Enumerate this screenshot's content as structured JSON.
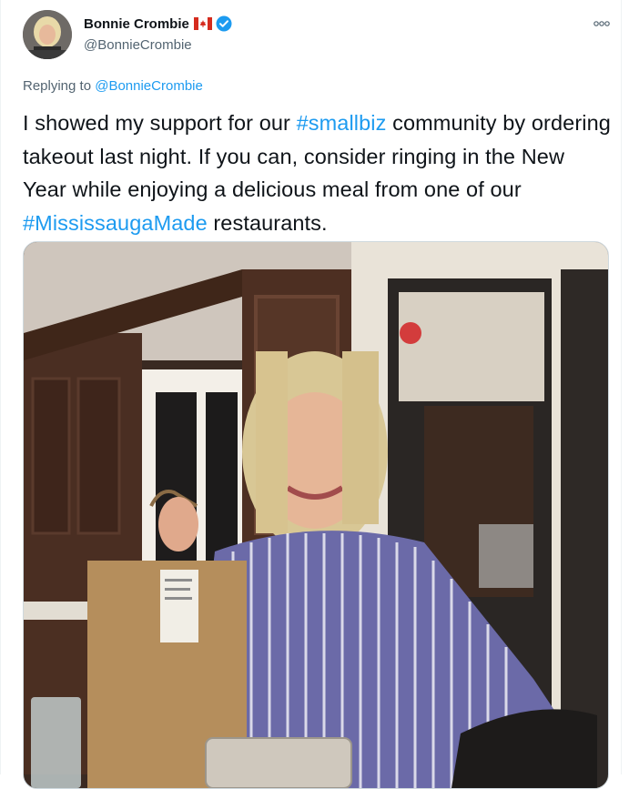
{
  "author": {
    "display_name": "Bonnie Crombie",
    "handle": "@BonnieCrombie",
    "flag_icon": "canada-flag-icon",
    "verified_icon": "verified-badge-icon"
  },
  "reply": {
    "prefix": "Replying to ",
    "mention": "@BonnieCrombie"
  },
  "tweet": {
    "part1": "I showed my support for our ",
    "hashtag1": "#smallbiz",
    "part2": " community by ordering takeout last night. If you can, consider ringing in the New Year while enjoying a delicious meal from one of our ",
    "hashtag2": "#MississaugaMade",
    "part3": " restaurants."
  },
  "colors": {
    "link": "#1d9bf0",
    "secondary_text": "#536471",
    "primary_text": "#0f1419",
    "verified": "#1d9bf0"
  },
  "media": {
    "icon": "photo-image"
  }
}
